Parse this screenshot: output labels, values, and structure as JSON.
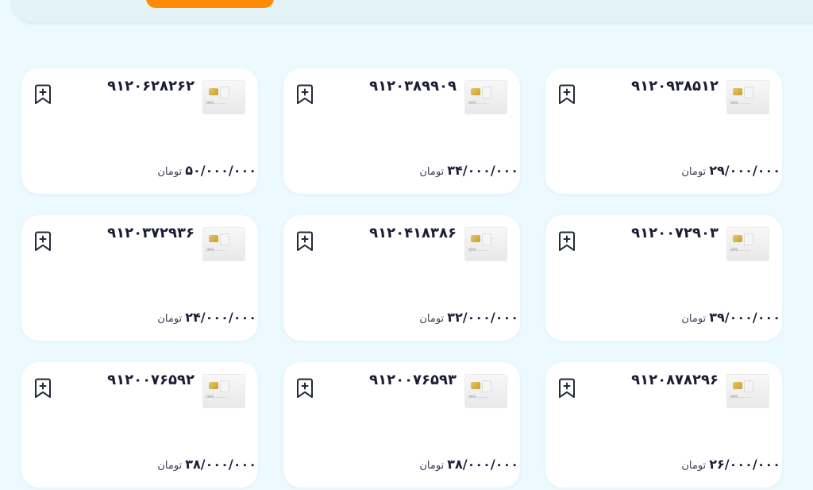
{
  "header": {
    "accent_tab_color": "#ff8a05"
  },
  "cards": [
    {
      "number": "۹۱۲۰۹۳۸۵۱۲",
      "price": "۲۹/۰۰۰/۰۰۰",
      "currency": "تومان",
      "sim_label": "OMG ...........",
      "bookmark_icon": "bookmark-plus-icon"
    },
    {
      "number": "۹۱۲۰۳۸۹۹۰۹",
      "price": "۳۴/۰۰۰/۰۰۰",
      "currency": "تومان",
      "sim_label": "OMG ...........",
      "bookmark_icon": "bookmark-plus-icon"
    },
    {
      "number": "۹۱۲۰۶۲۸۲۶۲",
      "price": "۵۰/۰۰۰/۰۰۰",
      "currency": "تومان",
      "sim_label": "OMG ...........",
      "bookmark_icon": "bookmark-plus-icon"
    },
    {
      "number": "۹۱۲۰۰۷۲۹۰۳",
      "price": "۳۹/۰۰۰/۰۰۰",
      "currency": "تومان",
      "sim_label": "OMG ...........",
      "bookmark_icon": "bookmark-plus-icon"
    },
    {
      "number": "۹۱۲۰۴۱۸۳۸۶",
      "price": "۳۲/۰۰۰/۰۰۰",
      "currency": "تومان",
      "sim_label": "OMG ...........",
      "bookmark_icon": "bookmark-plus-icon"
    },
    {
      "number": "۹۱۲۰۳۷۲۹۳۶",
      "price": "۲۴/۰۰۰/۰۰۰",
      "currency": "تومان",
      "sim_label": "OMG ...........",
      "bookmark_icon": "bookmark-plus-icon"
    },
    {
      "number": "۹۱۲۰۸۷۸۲۹۶",
      "price": "۲۶/۰۰۰/۰۰۰",
      "currency": "تومان",
      "sim_label": "OMG ...........",
      "bookmark_icon": "bookmark-plus-icon"
    },
    {
      "number": "۹۱۲۰۰۷۶۵۹۳",
      "price": "۳۸/۰۰۰/۰۰۰",
      "currency": "تومان",
      "sim_label": "OMG ...........",
      "bookmark_icon": "bookmark-plus-icon"
    },
    {
      "number": "۹۱۲۰۰۷۶۵۹۲",
      "price": "۳۸/۰۰۰/۰۰۰",
      "currency": "تومان",
      "sim_label": "OMG ...........",
      "bookmark_icon": "bookmark-plus-icon"
    }
  ]
}
